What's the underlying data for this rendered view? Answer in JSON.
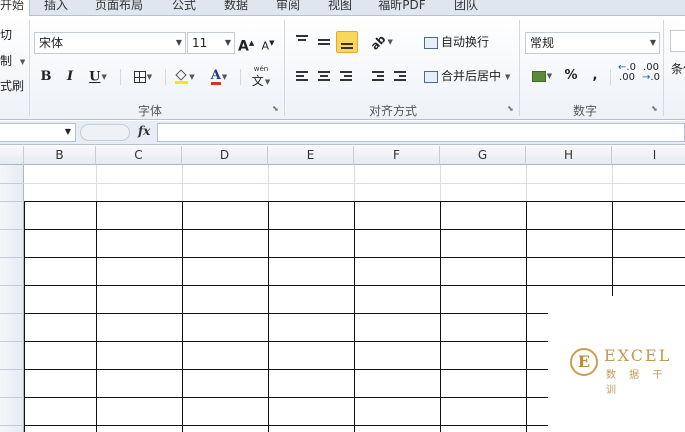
{
  "tabs": [
    "开始",
    "插入",
    "页面布局",
    "公式",
    "数据",
    "审阅",
    "视图",
    "福昕PDF",
    "团队"
  ],
  "active_tab": "开始",
  "clipboard": {
    "cut": "切",
    "copy": "制",
    "format_painter": "式刷"
  },
  "font": {
    "name": "宋体",
    "size": "11",
    "grow": "A",
    "shrink": "A",
    "bold": "B",
    "italic": "I",
    "underline": "U",
    "phonetic_top": "wén",
    "phonetic_char": "文",
    "font_color_letter": "A",
    "group_label": "字体"
  },
  "alignment": {
    "wrap_text": "自动换行",
    "merge_center": "合并后居中",
    "group_label": "对齐方式"
  },
  "number": {
    "format": "常规",
    "percent": "%",
    "comma": ",",
    "dec_increase": ".0",
    "dec_increase_sub": ".00",
    "dec_decrease": ".00",
    "dec_decrease_sub": ".0",
    "group_label": "数字"
  },
  "styles": {
    "conditional_partial": "条件"
  },
  "formula_bar": {
    "fx": "fx",
    "name_box": "",
    "content": ""
  },
  "columns": [
    "B",
    "C",
    "D",
    "E",
    "F",
    "G",
    "H",
    "I"
  ],
  "watermark": {
    "mark": "E",
    "title": "EXCEL",
    "subtitle": "数 据 干 训"
  },
  "colors": {
    "highlight_yellow": "#ffd55a",
    "font_color_red": "#d8302a",
    "fill_yellow": "#ffe800",
    "watermark_gold": "#c19a50",
    "ribbon_bg": "#f3f6fa",
    "tab_bg": "#dfe6ef"
  }
}
